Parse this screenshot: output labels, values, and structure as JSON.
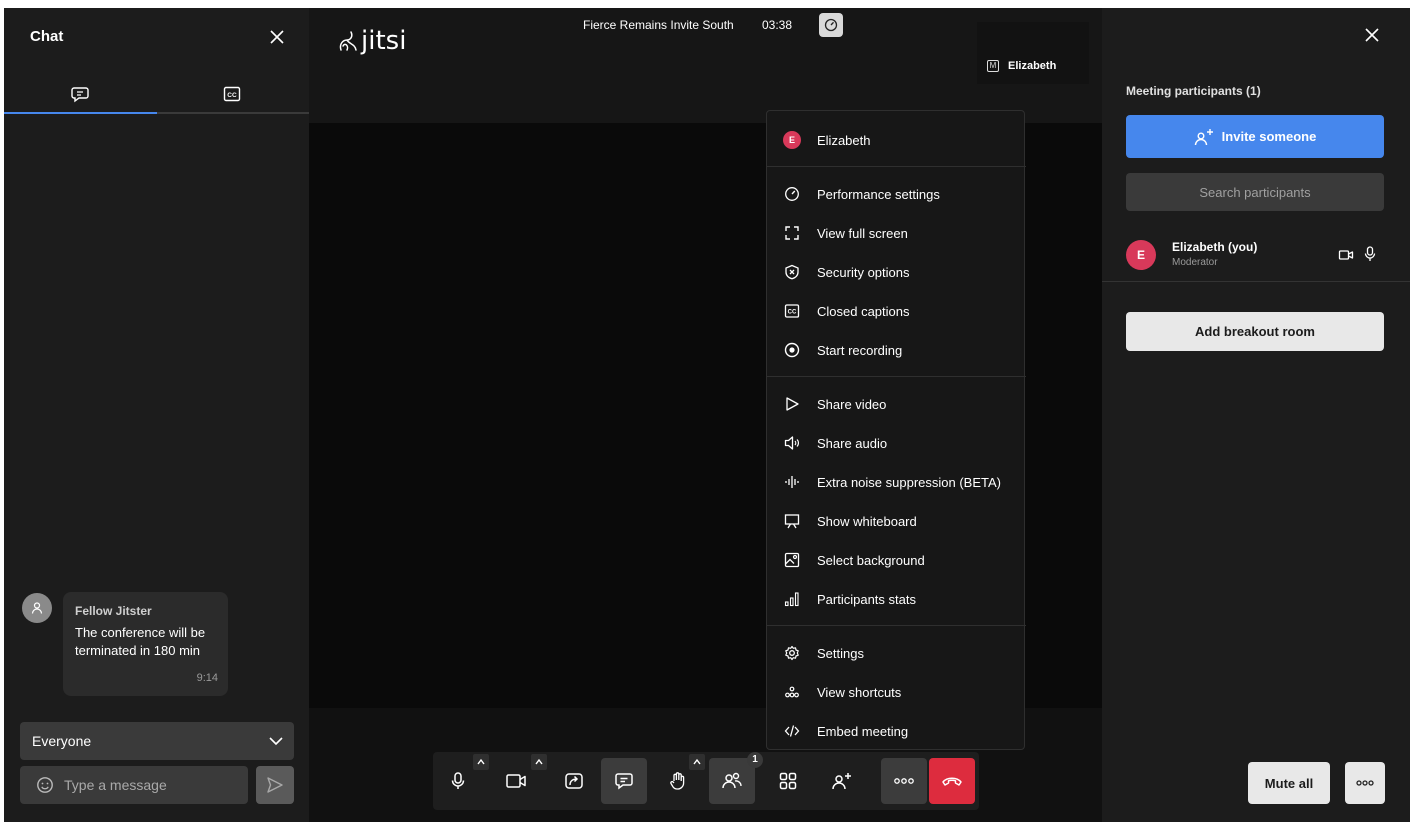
{
  "chat": {
    "title": "Chat",
    "tabs": [
      {
        "icon": "chat-bubble-icon"
      },
      {
        "icon": "closed-captions-icon"
      }
    ],
    "message": {
      "sender": "Fellow Jitster",
      "text": "The conference will be terminated in 180 min",
      "time": "9:14"
    },
    "recipient": "Everyone",
    "input_placeholder": "Type a message"
  },
  "stage": {
    "logo_text": "jitsi",
    "meeting_name": "Fierce Remains Invite South",
    "timer": "03:38",
    "self_badge": "M",
    "self_name": "Elizabeth"
  },
  "toolbar": {
    "buttons": [
      "microphone",
      "camera",
      "share-screen",
      "chat",
      "raise-hand",
      "participants",
      "tile-view",
      "invite",
      "more-actions",
      "hangup"
    ],
    "participants_badge": "1"
  },
  "menu": {
    "user": {
      "initial": "E",
      "name": "Elizabeth"
    },
    "group1": [
      {
        "icon": "gauge-icon",
        "label": "Performance settings"
      },
      {
        "icon": "fullscreen-icon",
        "label": "View full screen"
      },
      {
        "icon": "shield-icon",
        "label": "Security options"
      },
      {
        "icon": "closed-captions-icon",
        "label": "Closed captions"
      },
      {
        "icon": "record-icon",
        "label": "Start recording"
      }
    ],
    "group2": [
      {
        "icon": "play-icon",
        "label": "Share video"
      },
      {
        "icon": "speaker-icon",
        "label": "Share audio"
      },
      {
        "icon": "waveform-icon",
        "label": "Extra noise suppression (BETA)"
      },
      {
        "icon": "whiteboard-icon",
        "label": "Show whiteboard"
      },
      {
        "icon": "image-icon",
        "label": "Select background"
      },
      {
        "icon": "bar-stats-icon",
        "label": "Participants stats"
      }
    ],
    "group3": [
      {
        "icon": "gear-icon",
        "label": "Settings"
      },
      {
        "icon": "shortcuts-icon",
        "label": "View shortcuts"
      },
      {
        "icon": "code-icon",
        "label": "Embed meeting"
      }
    ]
  },
  "participants": {
    "title": "Meeting participants (1)",
    "invite_label": "Invite someone",
    "search_placeholder": "Search participants",
    "list": [
      {
        "initial": "E",
        "name": "Elizabeth (you)",
        "role": "Moderator"
      }
    ],
    "breakout_label": "Add breakout room",
    "mute_all_label": "Mute all"
  },
  "colors": {
    "accent": "#4687ed",
    "hangup": "#dd2c3e",
    "avatar": "#d8395a",
    "panel": "#1c1c1c"
  }
}
